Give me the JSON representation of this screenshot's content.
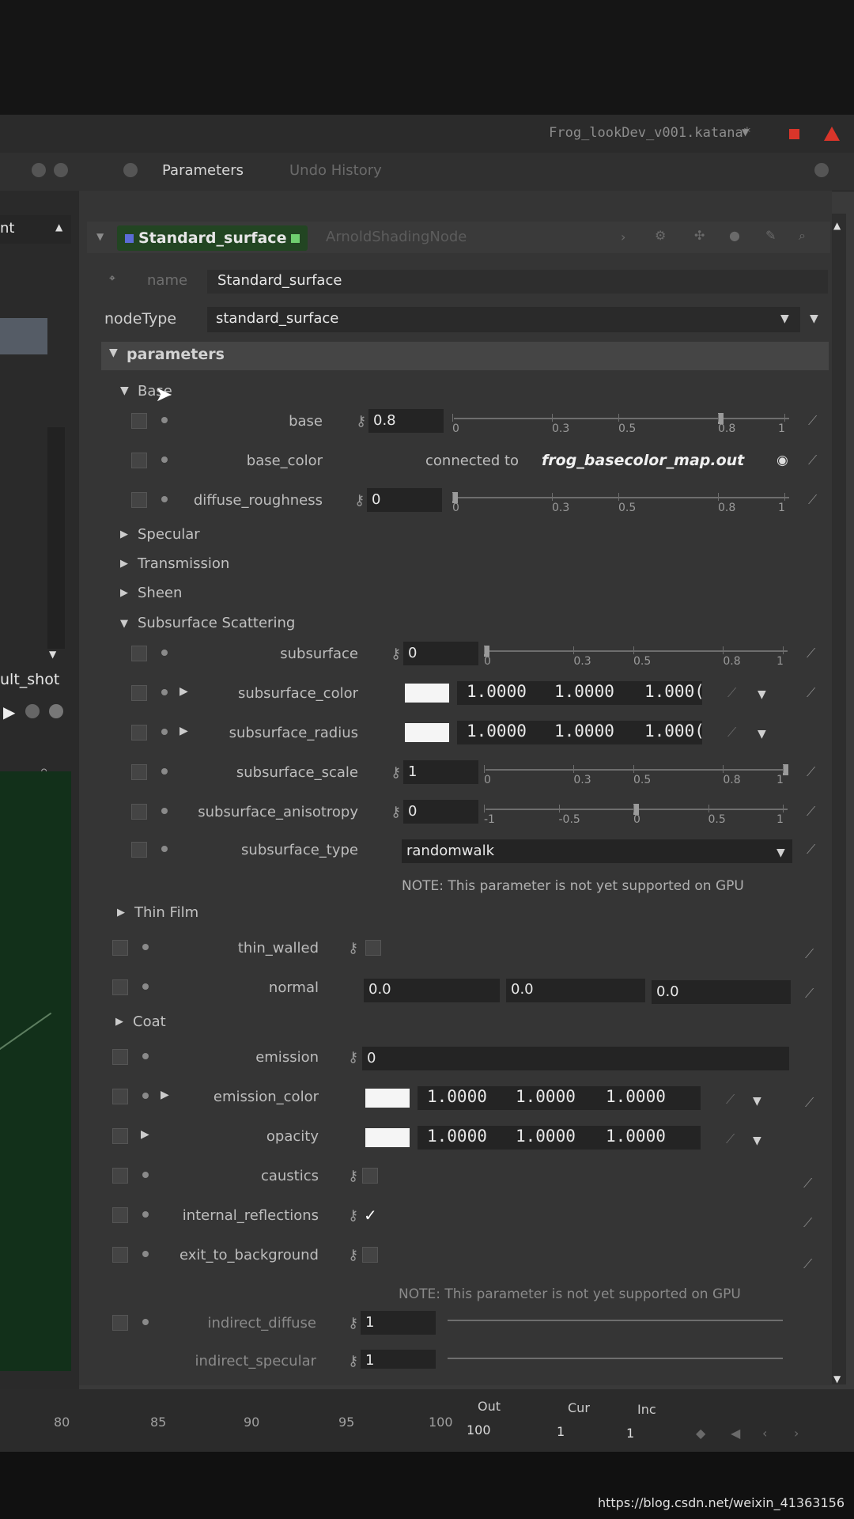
{
  "window": {
    "file_title": "Frog_lookDev_v001.katana*"
  },
  "tabs": [
    {
      "label": "Parameters",
      "active": true
    },
    {
      "label": "Undo History",
      "active": false
    }
  ],
  "left_panel": {
    "header_fragment": "nt",
    "shot_fragment": "ult_shot"
  },
  "node": {
    "name": "Standard_surface",
    "type_label": "ArnoldShadingNode"
  },
  "fields": {
    "name_label": "name",
    "name_value": "Standard_surface",
    "nodetype_label": "nodeType",
    "nodetype_value": "standard_surface"
  },
  "sections": {
    "parameters": "parameters",
    "base": "Base",
    "specular": "Specular",
    "transmission": "Transmission",
    "sheen": "Sheen",
    "subsurface_scattering": "Subsurface Scattering",
    "thin_film": "Thin Film",
    "coat": "Coat"
  },
  "params": {
    "base": {
      "label": "base",
      "value": "0.8",
      "level": 0.8
    },
    "base_color": {
      "label": "base_color",
      "connected_prefix": "connected to",
      "connected_target": "frog_basecolor_map.out"
    },
    "diffuse_roughness": {
      "label": "diffuse_roughness",
      "value": "0",
      "level": 0
    },
    "subsurface": {
      "label": "subsurface",
      "value": "0",
      "level": 0
    },
    "subsurface_color": {
      "label": "subsurface_color",
      "r": "1.0000",
      "g": "1.0000",
      "b": "1.000("
    },
    "subsurface_radius": {
      "label": "subsurface_radius",
      "r": "1.0000",
      "g": "1.0000",
      "b": "1.000("
    },
    "subsurface_scale": {
      "label": "subsurface_scale",
      "value": "1",
      "level": 1
    },
    "subsurface_anisotropy": {
      "label": "subsurface_anisotropy",
      "value": "0",
      "level": 0
    },
    "subsurface_type": {
      "label": "subsurface_type",
      "value": "randomwalk"
    },
    "thin_walled": {
      "label": "thin_walled"
    },
    "normal": {
      "label": "normal",
      "x": "0.0",
      "y": "0.0",
      "z": "0.0"
    },
    "emission": {
      "label": "emission",
      "value": "0"
    },
    "emission_color": {
      "label": "emission_color",
      "r": "1.0000",
      "g": "1.0000",
      "b": "1.0000"
    },
    "opacity": {
      "label": "opacity",
      "r": "1.0000",
      "g": "1.0000",
      "b": "1.0000"
    },
    "caustics": {
      "label": "caustics"
    },
    "internal_reflections": {
      "label": "internal_reflections",
      "check": "✓"
    },
    "exit_to_background": {
      "label": "exit_to_background"
    },
    "indirect_diffuse": {
      "label": "indirect_diffuse",
      "value": "1"
    },
    "indirect_specular": {
      "label": "indirect_specular",
      "value": "1"
    }
  },
  "slider_ticks_01": [
    "0",
    "0.3",
    "0.5",
    "0.8",
    "1"
  ],
  "slider_ticks_m11": [
    "-1",
    "-0.5",
    "0",
    "0.5",
    "1"
  ],
  "notes": {
    "gpu_note": "NOTE: This parameter is not yet supported on GPU"
  },
  "timeline": {
    "frames": [
      "80",
      "85",
      "90",
      "95",
      "100"
    ],
    "out_label": "Out",
    "out_value": "100",
    "cur_label": "Cur",
    "cur_value": "1",
    "inc_label": "Inc",
    "inc_value": "1"
  },
  "watermark": "https://blog.csdn.net/weixin_41363156",
  "colors": {
    "node_chip_bg": "#224522",
    "stop": "#d9352a",
    "swatch": "#f5f5f5"
  }
}
